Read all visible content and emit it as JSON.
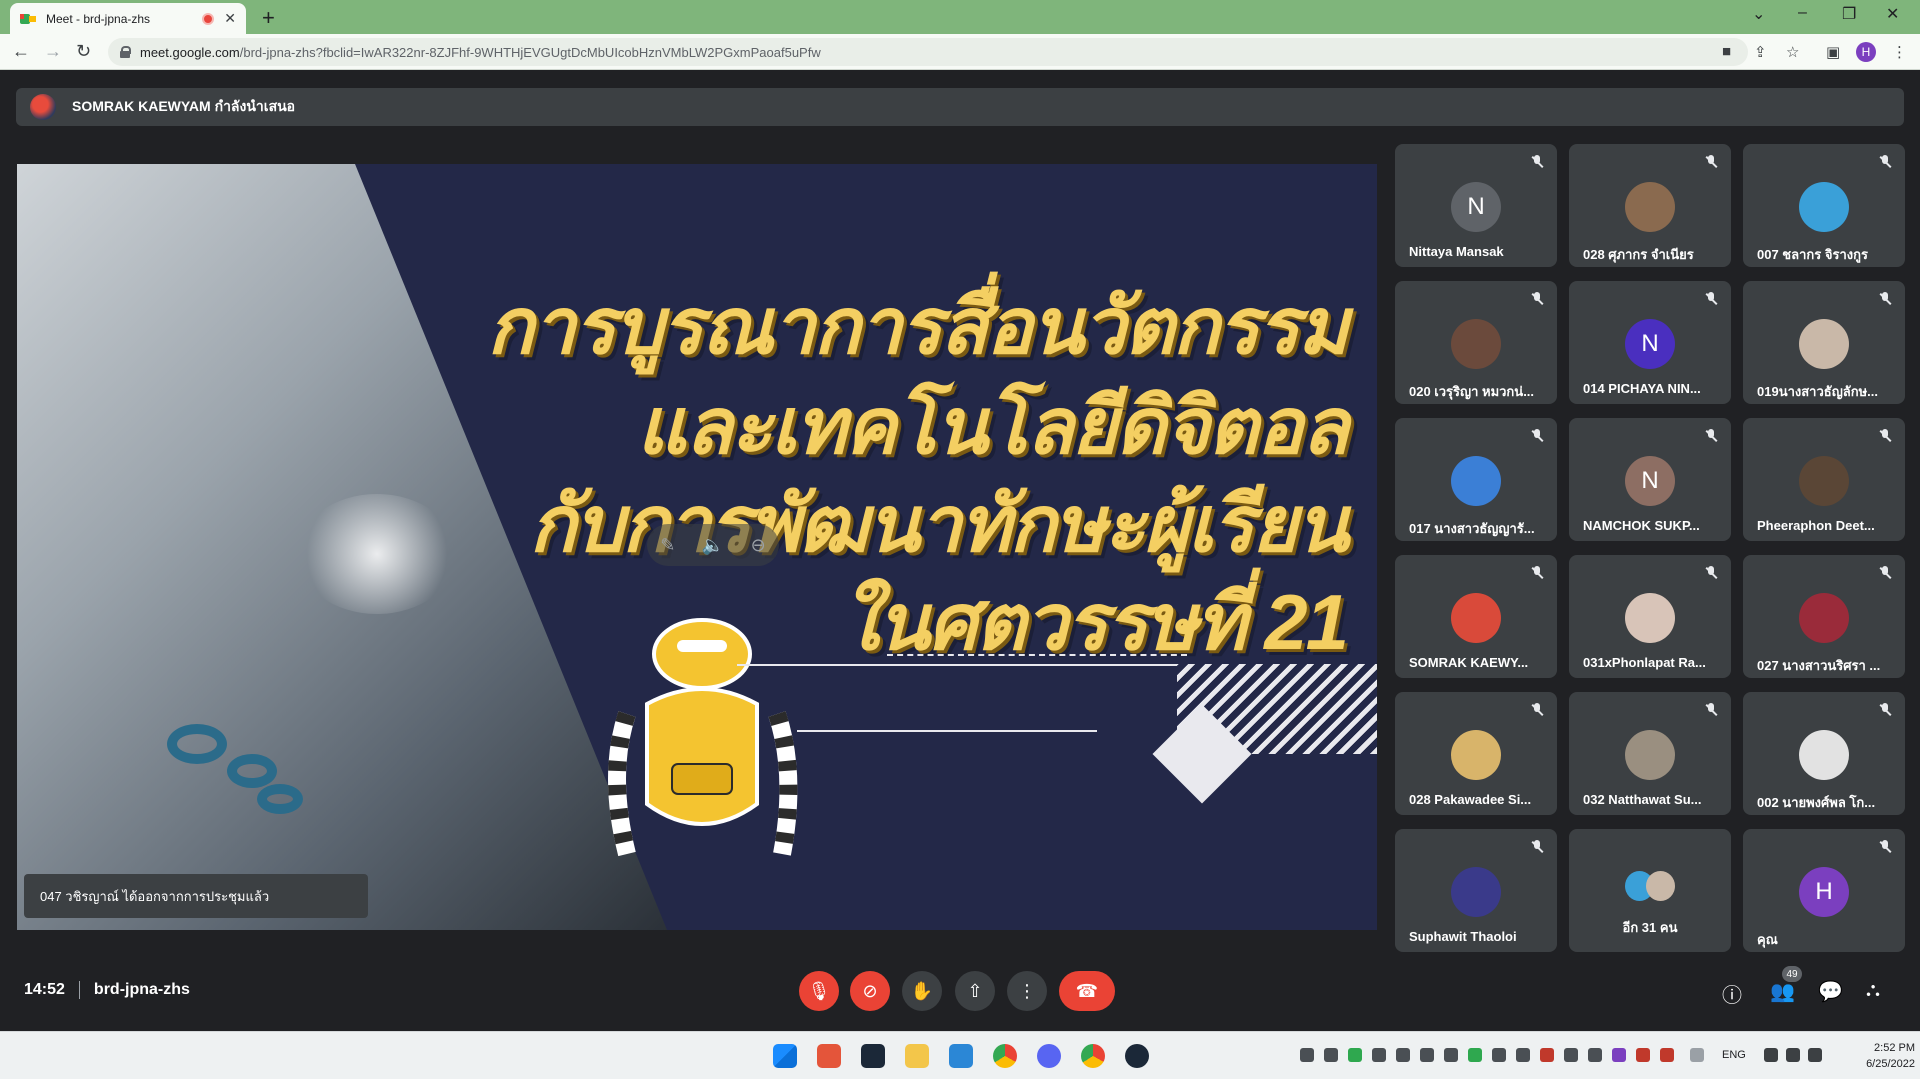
{
  "browser": {
    "tab_title": "Meet - brd-jpna-zhs",
    "new_tab": "+",
    "url_host": "meet.google.com",
    "url_path": "/brd-jpna-zhs?fbclid=IwAR322nr-8ZJFhf-9WHTHjEVGUgtDcMbUIcobHznVMbLW2PGxmPaoaf5uPfw",
    "profile_initial": "H"
  },
  "presenter_banner": "SOMRAK KAEWYAM กำลังนำเสนอ",
  "slide": {
    "lines": [
      "การบูรณาการสื่อนวัตกรรม",
      "และเทคโนโลยีดิจิตอล",
      "กับการพัฒนาทักษะผู้เรียน",
      "ในศตวรรษที่ 21"
    ]
  },
  "toast": "047 วชิรญาณ์ ได้ออกจากการประชุมแล้ว",
  "participants": [
    {
      "name": "Nittaya Mansak",
      "initial": "N",
      "color": "#5f6368"
    },
    {
      "name": "028 ศุภากร จำเนียร",
      "initial": "",
      "color": "#8a6a4f"
    },
    {
      "name": "007 ชลากร จิรางกูร",
      "initial": "",
      "color": "#3aa0d8"
    },
    {
      "name": "020 เวรุริญา หมวกน่...",
      "initial": "",
      "color": "#6b4a3c"
    },
    {
      "name": "014 PICHAYA NIN...",
      "initial": "N",
      "color": "#4a2fbf"
    },
    {
      "name": "019นางสาวธัญลักษ...",
      "initial": "",
      "color": "#c9b8a8"
    },
    {
      "name": "017 นางสาวธัญญารั...",
      "initial": "",
      "color": "#3b7fd6"
    },
    {
      "name": "NAMCHOK SUKP...",
      "initial": "N",
      "color": "#8d6e63"
    },
    {
      "name": "Pheeraphon Deet...",
      "initial": "",
      "color": "#5a4636"
    },
    {
      "name": "SOMRAK KAEWY...",
      "initial": "",
      "color": "#d94a3a"
    },
    {
      "name": "031xPhonlapat Ra...",
      "initial": "",
      "color": "#d8c4b8"
    },
    {
      "name": "027 นางสาวนริศรา ...",
      "initial": "",
      "color": "#9a2b3a"
    },
    {
      "name": "028 Pakawadee Si...",
      "initial": "",
      "color": "#d8b46a"
    },
    {
      "name": "032 Natthawat Su...",
      "initial": "",
      "color": "#9a8f80"
    },
    {
      "name": "002 นายพงศ์พล โก...",
      "initial": "",
      "color": "#e2e2e2"
    },
    {
      "name": "Suphawit Thaoloi",
      "initial": "",
      "color": "#3a3a8a"
    },
    {
      "name": "อีก 31 คน",
      "initial": "",
      "color": "#5f6368"
    },
    {
      "name": "คุณ",
      "initial": "H",
      "color": "#7b3fbf"
    }
  ],
  "meeting": {
    "time": "14:52",
    "code": "brd-jpna-zhs",
    "participant_count": "49"
  },
  "taskbar": {
    "lang": "ENG",
    "time": "2:52 PM",
    "date": "6/25/2022"
  }
}
